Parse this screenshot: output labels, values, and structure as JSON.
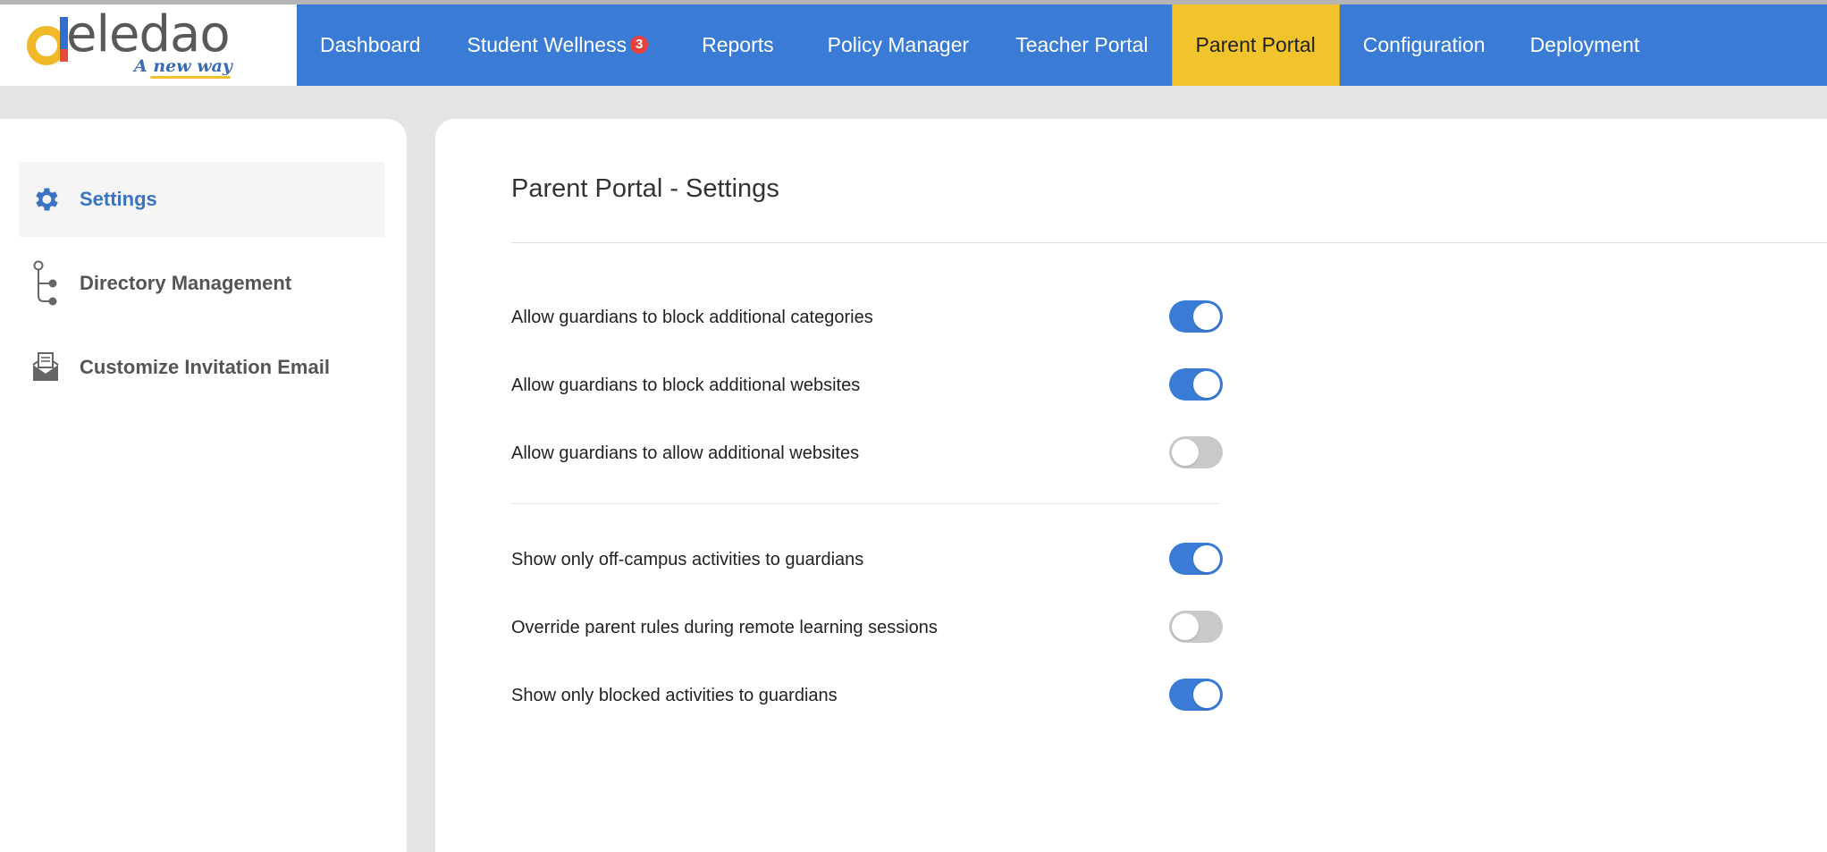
{
  "brand": {
    "name": "eledao",
    "tagline": "A new way",
    "colors": {
      "primary": "#3a7bd5",
      "active_tab": "#f2c42c",
      "badge": "#e8413c"
    }
  },
  "nav": {
    "items": [
      {
        "label": "Dashboard"
      },
      {
        "label": "Student Wellness",
        "badge": "3"
      },
      {
        "label": "Reports"
      },
      {
        "label": "Policy Manager"
      },
      {
        "label": "Teacher Portal"
      },
      {
        "label": "Parent Portal",
        "active": true
      },
      {
        "label": "Configuration"
      },
      {
        "label": "Deployment"
      }
    ]
  },
  "sidebar": {
    "items": [
      {
        "label": "Settings",
        "icon": "gear-icon",
        "active": true
      },
      {
        "label": "Directory Management",
        "icon": "tree-icon"
      },
      {
        "label": "Customize Invitation Email",
        "icon": "envelope-icon"
      }
    ]
  },
  "main": {
    "title": "Parent Portal - Settings",
    "settings": [
      {
        "label": "Allow guardians to block additional categories",
        "enabled": true
      },
      {
        "label": "Allow guardians to block additional websites",
        "enabled": true
      },
      {
        "label": "Allow guardians to allow additional websites",
        "enabled": false
      },
      {
        "label": "Show only off-campus activities to guardians",
        "enabled": true
      },
      {
        "label": "Override parent rules during remote learning sessions",
        "enabled": false
      },
      {
        "label": "Show only blocked activities to guardians",
        "enabled": true
      }
    ]
  }
}
